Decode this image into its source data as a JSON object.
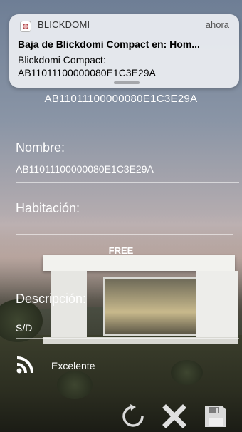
{
  "notification": {
    "app_name": "BLICKDOMI",
    "time": "ahora",
    "title": "Baja de Blickdomi Compact en: Hom...",
    "body_line1": "Blickdomi Compact:",
    "body_line2": "AB11011100000080E1C3E29A"
  },
  "device": {
    "header_id": "AB11011100000080E1C3E29A"
  },
  "form": {
    "name_label": "Nombre:",
    "name_value": "AB11011100000080E1C3E29A",
    "room_label": "Habitación:",
    "room_value": "FREE",
    "description_label": "Descripción:",
    "description_value": "S/D"
  },
  "signal": {
    "quality": "Excelente",
    "icon": "wifi-signal-icon"
  },
  "actions": {
    "refresh_icon": "refresh-icon",
    "delete_icon": "close-icon",
    "save_icon": "save-icon"
  }
}
